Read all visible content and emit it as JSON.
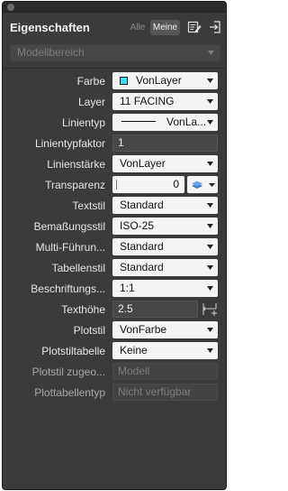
{
  "panel": {
    "title": "Eigenschaften",
    "tab_alle": "Alle",
    "tab_meine": "Meine",
    "header_icons": [
      "edit-icon",
      "export-icon"
    ],
    "object_select": "Modellbereich"
  },
  "properties": [
    {
      "label": "Farbe",
      "value": "VonLayer",
      "kind": "select",
      "swatch": "#44d6f2"
    },
    {
      "label": "Layer",
      "value": "11 FACING",
      "kind": "select"
    },
    {
      "label": "Linientyp",
      "value": "VonLa...",
      "kind": "select-line"
    },
    {
      "label": "Linientypfaktor",
      "value": "1",
      "kind": "input"
    },
    {
      "label": "Linienstärke",
      "value": "VonLayer",
      "kind": "select"
    },
    {
      "label": "Transparenz",
      "value": "0",
      "kind": "transparency"
    },
    {
      "label": "Textstil",
      "value": "Standard",
      "kind": "select"
    },
    {
      "label": "Bemaßungsstil",
      "value": "ISO-25",
      "kind": "select"
    },
    {
      "label": "Multi-Führun...",
      "value": "Standard",
      "kind": "select"
    },
    {
      "label": "Tabellenstil",
      "value": "Standard",
      "kind": "select"
    },
    {
      "label": "Beschriftungs...",
      "value": "1:1",
      "kind": "select"
    },
    {
      "label": "Texthöhe",
      "value": "2.5",
      "kind": "input-pick"
    },
    {
      "label": "Plotstil",
      "value": "VonFarbe",
      "kind": "select"
    },
    {
      "label": "Plotstiltabelle",
      "value": "Keine",
      "kind": "select"
    },
    {
      "label": "Plotstil zugeo...",
      "value": "Modell",
      "kind": "disabled"
    },
    {
      "label": "Plottabellentyp",
      "value": "Nicht verfügbar",
      "kind": "disabled"
    }
  ]
}
